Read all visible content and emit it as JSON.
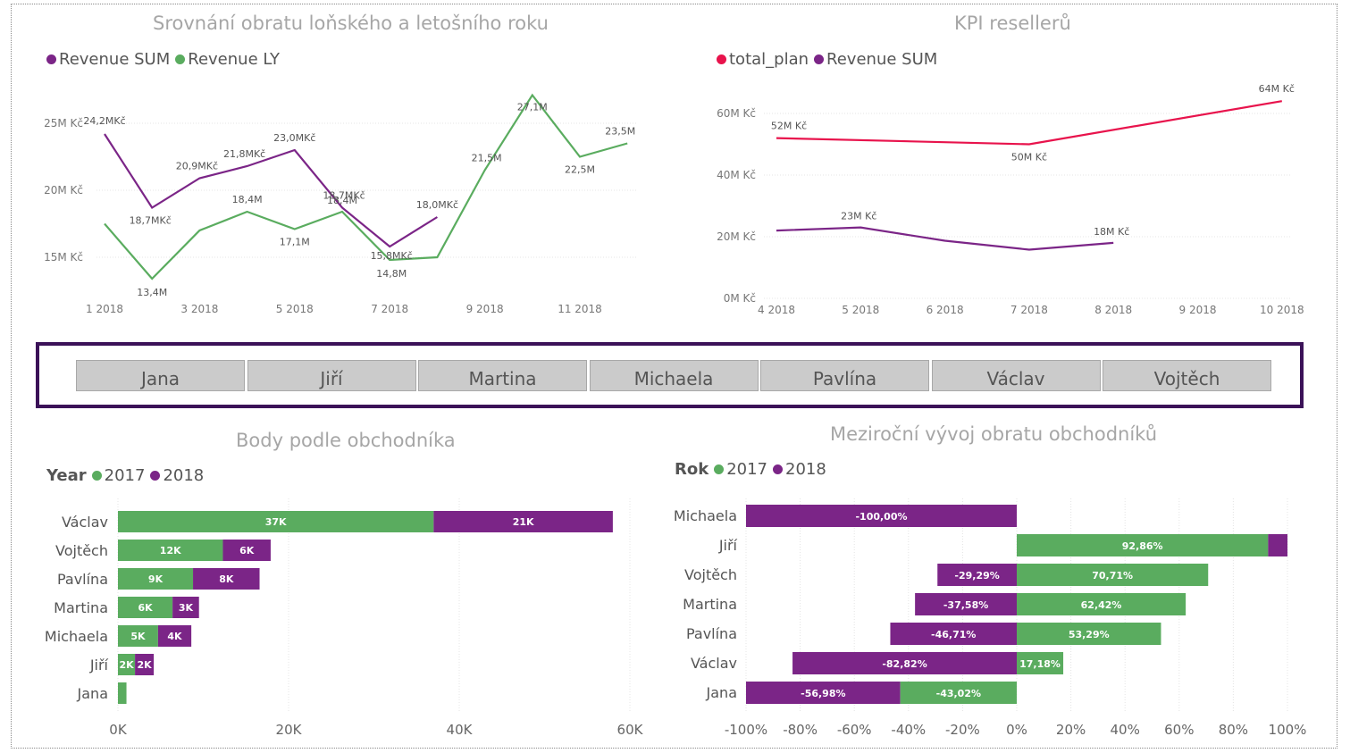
{
  "colors": {
    "revenue_sum": "#7b2587",
    "revenue_ly": "#5aac5f",
    "total_plan": "#e8134c",
    "year_2017": "#5aac5f",
    "year_2018": "#7b2587",
    "grid": "#e4e4e4",
    "slicer_border": "#3b1258",
    "slicer_button": "#cbcbcb"
  },
  "slicer": {
    "items": [
      "Jana",
      "Jiří",
      "Martina",
      "Michaela",
      "Pavlína",
      "Václav",
      "Vojtěch"
    ]
  },
  "chart_data": [
    {
      "type": "line",
      "title": "Srovnání obratu loňského a letošního roku",
      "legend": [
        "Revenue SUM",
        "Revenue LY"
      ],
      "x": [
        1,
        2,
        3,
        4,
        5,
        6,
        7,
        8,
        9,
        10,
        11,
        12
      ],
      "x_tick_labels": [
        "1 2018",
        "3 2018",
        "5 2018",
        "7 2018",
        "9 2018",
        "11 2018"
      ],
      "y_tick_labels": [
        "15M Kč",
        "20M Kč",
        "25M Kč"
      ],
      "ylim": [
        13,
        28
      ],
      "grid": true,
      "series": [
        {
          "name": "Revenue SUM",
          "values": [
            24.2,
            18.7,
            20.9,
            21.8,
            23.0,
            18.7,
            15.8,
            18.0
          ],
          "labels": [
            "24,2MKč",
            "18,7MKč",
            "20,9MKč",
            "21,8MKč",
            "23,0MKč",
            "18,7MKč",
            "15,8MKč",
            "18,0MKč"
          ]
        },
        {
          "name": "Revenue LY",
          "values": [
            17.5,
            13.4,
            17.0,
            18.4,
            17.1,
            18.4,
            14.8,
            15.0,
            21.5,
            27.1,
            22.5,
            23.5
          ],
          "labels": [
            "",
            "13,4M",
            "",
            "18,4M",
            "17,1M",
            "18,4M",
            "14,8M",
            "",
            "21,5M",
            "27,1M",
            "22,5M",
            "23,5M"
          ]
        }
      ]
    },
    {
      "type": "line",
      "title": "KPI resellerů",
      "legend": [
        "total_plan",
        "Revenue SUM"
      ],
      "x": [
        4,
        5,
        6,
        7,
        8,
        9,
        10
      ],
      "x_tick_labels": [
        "4 2018",
        "5 2018",
        "6 2018",
        "7 2018",
        "8 2018",
        "9 2018",
        "10 2018"
      ],
      "y_tick_labels": [
        "0M Kč",
        "20M Kč",
        "40M Kč",
        "60M Kč"
      ],
      "ylim": [
        0,
        70
      ],
      "grid": true,
      "series": [
        {
          "name": "total_plan",
          "points": [
            [
              4,
              52
            ],
            [
              7,
              50
            ],
            [
              10,
              64
            ]
          ],
          "labels": [
            "52M Kč",
            "50M Kč",
            "64M Kč"
          ]
        },
        {
          "name": "Revenue SUM",
          "points": [
            [
              4,
              22
            ],
            [
              5,
              23
            ],
            [
              6,
              18.7
            ],
            [
              7,
              15.8
            ],
            [
              8,
              18
            ]
          ],
          "labels": [
            "",
            "23M Kč",
            "",
            "",
            "18M Kč"
          ]
        }
      ]
    },
    {
      "type": "bar",
      "orientation": "horizontal",
      "stacked": true,
      "title": "Body podle obchodníka",
      "legend_title": "Year",
      "legend": [
        "2017",
        "2018"
      ],
      "categories": [
        "Václav",
        "Vojtěch",
        "Pavlína",
        "Martina",
        "Michaela",
        "Jiří",
        "Jana"
      ],
      "series": [
        {
          "name": "2017",
          "values": [
            37,
            12.3,
            8.8,
            6.4,
            4.7,
            2.0,
            1.0
          ],
          "labels": [
            "37K",
            "12K",
            "9K",
            "6K",
            "5K",
            "2K",
            ""
          ]
        },
        {
          "name": "2018",
          "values": [
            21,
            5.6,
            7.8,
            3.1,
            3.9,
            2.2,
            0
          ],
          "labels": [
            "21K",
            "6K",
            "8K",
            "3K",
            "4K",
            "2K",
            ""
          ]
        }
      ],
      "x_tick_labels": [
        "0K",
        "20K",
        "40K",
        "60K"
      ],
      "xlim": [
        0,
        60
      ],
      "grid": true
    },
    {
      "type": "bar",
      "orientation": "horizontal",
      "diverging": true,
      "title": "Meziroční vývoj obratu obchodníků",
      "legend_title": "Rok",
      "legend": [
        "2017",
        "2018"
      ],
      "categories": [
        "Michaela",
        "Jiří",
        "Vojtěch",
        "Martina",
        "Pavlína",
        "Václav",
        "Jana"
      ],
      "bars": [
        [
          {
            "series": "2018",
            "from": -100,
            "to": 0,
            "label": "-100,00%"
          }
        ],
        [
          {
            "series": "2017",
            "from": 0,
            "to": 92.86,
            "label": "92,86%"
          },
          {
            "series": "2018",
            "from": 92.86,
            "to": 100,
            "label": ""
          }
        ],
        [
          {
            "series": "2018",
            "from": -29.29,
            "to": 0,
            "label": "-29,29%"
          },
          {
            "series": "2017",
            "from": 0,
            "to": 70.71,
            "label": "70,71%"
          }
        ],
        [
          {
            "series": "2018",
            "from": -37.58,
            "to": 0,
            "label": "-37,58%"
          },
          {
            "series": "2017",
            "from": 0,
            "to": 62.42,
            "label": "62,42%"
          }
        ],
        [
          {
            "series": "2018",
            "from": -46.71,
            "to": 0,
            "label": "-46,71%"
          },
          {
            "series": "2017",
            "from": 0,
            "to": 53.29,
            "label": "53,29%"
          }
        ],
        [
          {
            "series": "2018",
            "from": -82.82,
            "to": 0,
            "label": "-82,82%"
          },
          {
            "series": "2017",
            "from": 0,
            "to": 17.18,
            "label": "17,18%"
          }
        ],
        [
          {
            "series": "2018",
            "from": -100,
            "to": -43.02,
            "label": "-56,98%"
          },
          {
            "series": "2017",
            "from": -43.02,
            "to": 0,
            "label": "-43,02%"
          }
        ]
      ],
      "x_tick_labels": [
        "-100%",
        "-80%",
        "-60%",
        "-40%",
        "-20%",
        "0%",
        "20%",
        "40%",
        "60%",
        "80%",
        "100%"
      ],
      "xlim": [
        -100,
        100
      ],
      "grid": true
    }
  ]
}
